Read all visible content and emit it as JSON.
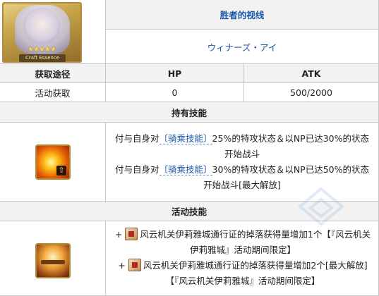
{
  "card": {
    "name_cn": "胜者的视线",
    "name_jp": "ウィナーズ・アイ",
    "portrait_stars": "★★★★★",
    "portrait_tag": "Craft Essence"
  },
  "stats": {
    "headers": [
      "获取途径",
      "HP",
      "ATK"
    ],
    "row": [
      "活动获取",
      "0",
      "500/2000"
    ]
  },
  "passive_skill": {
    "header": "持有技能",
    "lines": [
      {
        "prefix": "付与自身对",
        "trait": "〔骑乘技能〕",
        "rest": "25%的特攻状态＆以NP已达30%的状态开始战斗"
      },
      {
        "prefix": "付与自身对",
        "trait": "〔骑乘技能〕",
        "rest": "30%的特攻状态＆以NP已达50%的状态开始战斗[最大解放]"
      }
    ]
  },
  "event_skill": {
    "header": "活动技能",
    "lines": [
      {
        "bullet": "+",
        "text": "风云机关伊莉雅城通行证的掉落获得量增加1个【『风云机关伊莉雅城』活动期间限定】"
      },
      {
        "bullet": "+",
        "text": "风云机关伊莉雅城通行证的掉落获得量增加2个[最大解放]【『风云机关伊莉雅城』活动期间限定】"
      }
    ]
  },
  "colors": {
    "header_bg": "#f2f2f2",
    "border": "#c8c8c8",
    "link": "#1a56a8"
  }
}
